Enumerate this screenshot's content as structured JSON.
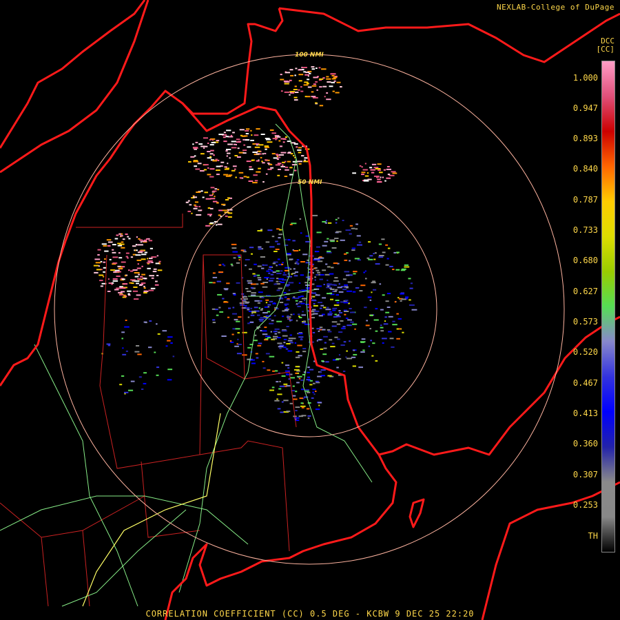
{
  "credit": "NEXLAB-College of DuPage",
  "legend": {
    "product": "DCC",
    "unit": "[CC]",
    "ticks": [
      "1.000",
      "0.947",
      "0.893",
      "0.840",
      "0.787",
      "0.733",
      "0.680",
      "0.627",
      "0.573",
      "0.520",
      "0.467",
      "0.413",
      "0.360",
      "0.307",
      "0.253",
      "TH"
    ],
    "colors": [
      "#ff9ec7",
      "#e0507a",
      "#cc0000",
      "#ff6600",
      "#ffcc00",
      "#dddd00",
      "#99cc00",
      "#55dd55",
      "#8888cc",
      "#3333dd",
      "#0000ff",
      "#2222aa",
      "#8a8a8a",
      "#888888",
      "#000000"
    ]
  },
  "rings": [
    {
      "label": "100 NMI"
    },
    {
      "label": "50 NMI"
    }
  ],
  "footer": "CORRELATION COEFFICIENT (CC) 0.5 DEG - KCBW 9 DEC 25 22:20",
  "colors": {
    "border_red": "#ff1a1a",
    "county": "#cc2222",
    "roads_green": "#88ee88",
    "highway_yellow": "#ffff66",
    "ring": "#ffb4a0",
    "text": "#ffd84a"
  }
}
